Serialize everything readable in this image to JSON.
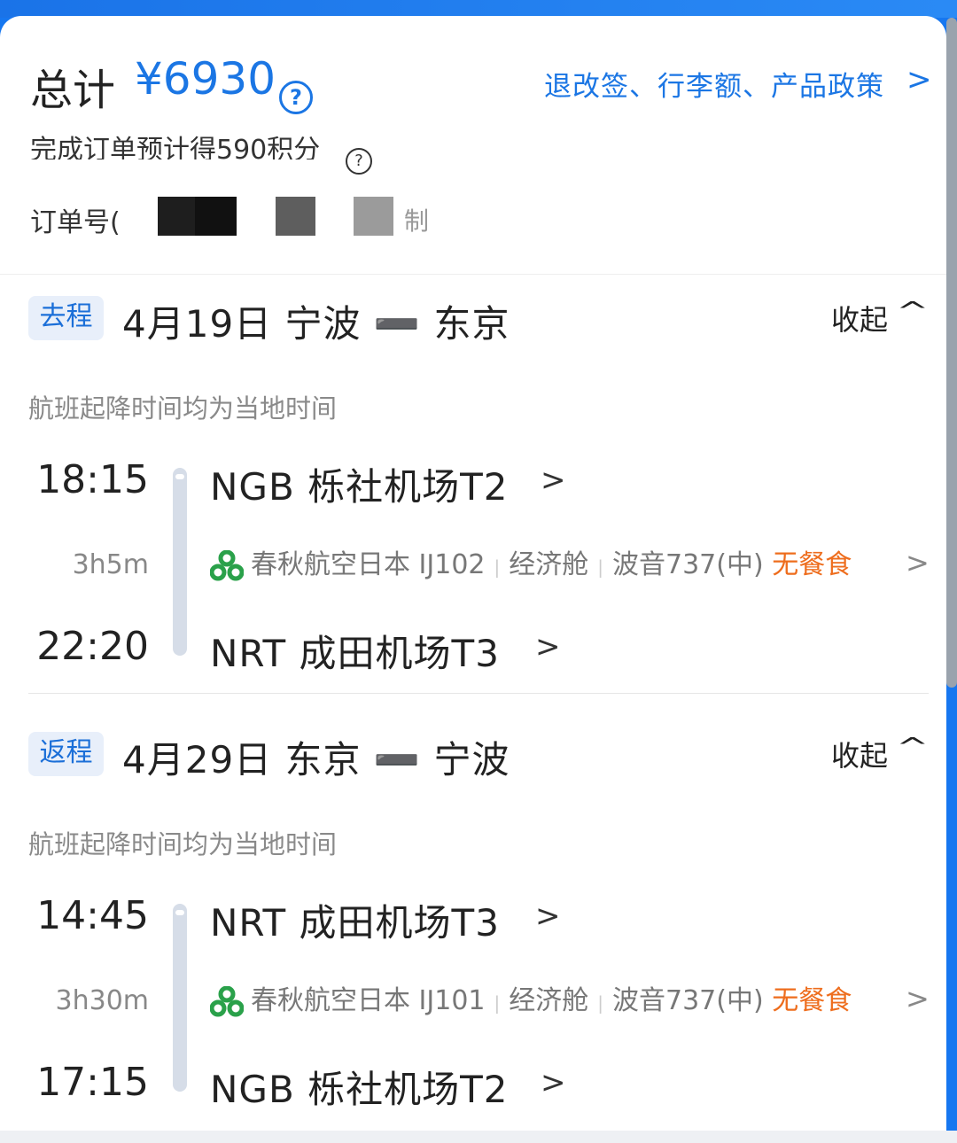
{
  "summary": {
    "total_label": "总计",
    "total_price": "¥6930",
    "help_symbol": "?",
    "policy_link": "退改签、行李额、产品政策",
    "policy_chevron": ">",
    "points_text": "完成订单预计得590积分",
    "order_label": "订单号(",
    "order_tail": "制"
  },
  "colors": {
    "accent": "#1b76e4",
    "meal": "#ee6d1d",
    "badge_bg": "#e8effa"
  },
  "segments": [
    {
      "badge": "去程",
      "title": "4月19日 宁波 ➖ 东京",
      "collapse": "收起",
      "collapse_icon": "^",
      "note": "航班起降时间均为当地时间",
      "depart_time": "18:15",
      "duration": "3h5m",
      "arrive_time": "22:20",
      "depart_airport": "NGB  栎社机场T2",
      "arrive_airport": "NRT  成田机场T3",
      "chevron": ">",
      "airline": "春秋航空日本 IJ102",
      "cabin": "经济舱",
      "aircraft": "波音737(中)",
      "meal": "无餐食"
    },
    {
      "badge": "返程",
      "title": "4月29日 东京 ➖ 宁波",
      "collapse": "收起",
      "collapse_icon": "^",
      "note": "航班起降时间均为当地时间",
      "depart_time": "14:45",
      "duration": "3h30m",
      "arrive_time": "17:15",
      "depart_airport": "NRT  成田机场T3",
      "arrive_airport": "NGB  栎社机场T2",
      "chevron": ">",
      "airline": "春秋航空日本 IJ101",
      "cabin": "经济舱",
      "aircraft": "波音737(中)",
      "meal": "无餐食"
    }
  ]
}
